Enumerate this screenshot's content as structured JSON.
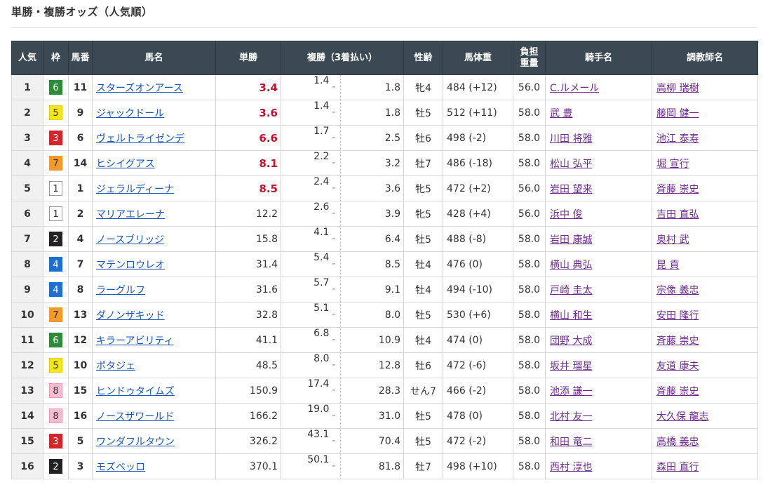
{
  "heading": "単勝・複勝オッズ（人気順）",
  "headers": {
    "rank": "人気",
    "waku": "枠",
    "umaban": "馬番",
    "horse": "馬名",
    "win": "単勝",
    "place": "複勝（3着払い）",
    "sex_age": "性齢",
    "body_weight": "馬体重",
    "load_1": "負担",
    "load_2": "重量",
    "jockey": "騎手名",
    "trainer": "調教師名"
  },
  "waku_colors": {
    "1": {
      "bg": "#ffffff",
      "fg": "#333333",
      "border": "#999999"
    },
    "2": {
      "bg": "#222222",
      "fg": "#ffffff",
      "border": "#222222"
    },
    "3": {
      "bg": "#d0262c",
      "fg": "#ffffff",
      "border": "#d0262c"
    },
    "4": {
      "bg": "#1e6fd0",
      "fg": "#ffffff",
      "border": "#1e6fd0"
    },
    "5": {
      "bg": "#f5e51d",
      "fg": "#333333",
      "border": "#e0cf00"
    },
    "6": {
      "bg": "#2e8b3a",
      "fg": "#ffffff",
      "border": "#2e8b3a"
    },
    "7": {
      "bg": "#f39a2b",
      "fg": "#333333",
      "border": "#f39a2b"
    },
    "8": {
      "bg": "#f6bdd1",
      "fg": "#333333",
      "border": "#e89ab6"
    }
  },
  "rows": [
    {
      "rank": "1",
      "waku": "6",
      "umaban": "11",
      "horse": "スターズオンアース",
      "win": "3.4",
      "hot": true,
      "place_lo": "1.4",
      "place_hi": "1.8",
      "sex_age": "牝4",
      "body_weight": "484 (+12)",
      "load": "56.0",
      "jockey": "C.ルメール",
      "trainer": "高柳 瑞樹"
    },
    {
      "rank": "2",
      "waku": "5",
      "umaban": "9",
      "horse": "ジャックドール",
      "win": "3.6",
      "hot": true,
      "place_lo": "1.4",
      "place_hi": "1.8",
      "sex_age": "牡5",
      "body_weight": "512 (+11)",
      "load": "58.0",
      "jockey": "武 豊",
      "trainer": "藤岡 健一"
    },
    {
      "rank": "3",
      "waku": "3",
      "umaban": "6",
      "horse": "ヴェルトライゼンデ",
      "win": "6.6",
      "hot": true,
      "place_lo": "1.7",
      "place_hi": "2.5",
      "sex_age": "牡6",
      "body_weight": "498 (-2)",
      "load": "58.0",
      "jockey": "川田 将雅",
      "trainer": "池江 泰寿"
    },
    {
      "rank": "4",
      "waku": "7",
      "umaban": "14",
      "horse": "ヒシイグアス",
      "win": "8.1",
      "hot": true,
      "place_lo": "2.2",
      "place_hi": "3.2",
      "sex_age": "牡7",
      "body_weight": "486 (-18)",
      "load": "58.0",
      "jockey": "松山 弘平",
      "trainer": "堀 宣行"
    },
    {
      "rank": "5",
      "waku": "1",
      "umaban": "1",
      "horse": "ジェラルディーナ",
      "win": "8.5",
      "hot": true,
      "place_lo": "2.4",
      "place_hi": "3.6",
      "sex_age": "牝5",
      "body_weight": "472 (+2)",
      "load": "56.0",
      "jockey": "岩田 望来",
      "trainer": "斉藤 崇史"
    },
    {
      "rank": "6",
      "waku": "1",
      "umaban": "2",
      "horse": "マリアエレーナ",
      "win": "12.2",
      "hot": false,
      "place_lo": "2.6",
      "place_hi": "3.9",
      "sex_age": "牝5",
      "body_weight": "428 (+4)",
      "load": "56.0",
      "jockey": "浜中 俊",
      "trainer": "吉田 直弘"
    },
    {
      "rank": "7",
      "waku": "2",
      "umaban": "4",
      "horse": "ノースブリッジ",
      "win": "15.8",
      "hot": false,
      "place_lo": "4.1",
      "place_hi": "6.4",
      "sex_age": "牡5",
      "body_weight": "488 (-8)",
      "load": "58.0",
      "jockey": "岩田 康誠",
      "trainer": "奥村 武"
    },
    {
      "rank": "8",
      "waku": "4",
      "umaban": "7",
      "horse": "マテンロウレオ",
      "win": "31.4",
      "hot": false,
      "place_lo": "5.4",
      "place_hi": "8.5",
      "sex_age": "牡4",
      "body_weight": "476 (0)",
      "load": "58.0",
      "jockey": "横山 典弘",
      "trainer": "昆 貢"
    },
    {
      "rank": "9",
      "waku": "4",
      "umaban": "8",
      "horse": "ラーグルフ",
      "win": "31.6",
      "hot": false,
      "place_lo": "5.7",
      "place_hi": "9.1",
      "sex_age": "牡4",
      "body_weight": "494 (-10)",
      "load": "58.0",
      "jockey": "戸崎 圭太",
      "trainer": "宗像 義忠"
    },
    {
      "rank": "10",
      "waku": "7",
      "umaban": "13",
      "horse": "ダノンザキッド",
      "win": "32.8",
      "hot": false,
      "place_lo": "5.1",
      "place_hi": "8.0",
      "sex_age": "牡5",
      "body_weight": "530 (+6)",
      "load": "58.0",
      "jockey": "横山 和生",
      "trainer": "安田 隆行"
    },
    {
      "rank": "11",
      "waku": "6",
      "umaban": "12",
      "horse": "キラーアビリティ",
      "win": "41.1",
      "hot": false,
      "place_lo": "6.8",
      "place_hi": "10.9",
      "sex_age": "牡4",
      "body_weight": "474 (0)",
      "load": "58.0",
      "jockey": "団野 大成",
      "trainer": "斉藤 崇史"
    },
    {
      "rank": "12",
      "waku": "5",
      "umaban": "10",
      "horse": "ポタジェ",
      "win": "48.5",
      "hot": false,
      "place_lo": "8.0",
      "place_hi": "12.8",
      "sex_age": "牡6",
      "body_weight": "472 (-6)",
      "load": "58.0",
      "jockey": "坂井 瑠星",
      "trainer": "友道 康夫"
    },
    {
      "rank": "13",
      "waku": "8",
      "umaban": "15",
      "horse": "ヒンドゥタイムズ",
      "win": "150.9",
      "hot": false,
      "place_lo": "17.4",
      "place_hi": "28.3",
      "sex_age": "せん7",
      "body_weight": "466 (-2)",
      "load": "58.0",
      "jockey": "池添 謙一",
      "trainer": "斉藤 崇史"
    },
    {
      "rank": "14",
      "waku": "8",
      "umaban": "16",
      "horse": "ノースザワールド",
      "win": "166.2",
      "hot": false,
      "place_lo": "19.0",
      "place_hi": "31.0",
      "sex_age": "牡5",
      "body_weight": "478 (0)",
      "load": "58.0",
      "jockey": "北村 友一",
      "trainer": "大久保 龍志"
    },
    {
      "rank": "15",
      "waku": "3",
      "umaban": "5",
      "horse": "ワンダフルタウン",
      "win": "326.2",
      "hot": false,
      "place_lo": "43.1",
      "place_hi": "70.4",
      "sex_age": "牡5",
      "body_weight": "472 (-2)",
      "load": "58.0",
      "jockey": "和田 竜二",
      "trainer": "高橋 義忠"
    },
    {
      "rank": "16",
      "waku": "2",
      "umaban": "3",
      "horse": "モズベッロ",
      "win": "370.1",
      "hot": false,
      "place_lo": "50.1",
      "place_hi": "81.8",
      "sex_age": "牡7",
      "body_weight": "498 (+10)",
      "load": "58.0",
      "jockey": "西村 淳也",
      "trainer": "森田 直行"
    }
  ]
}
